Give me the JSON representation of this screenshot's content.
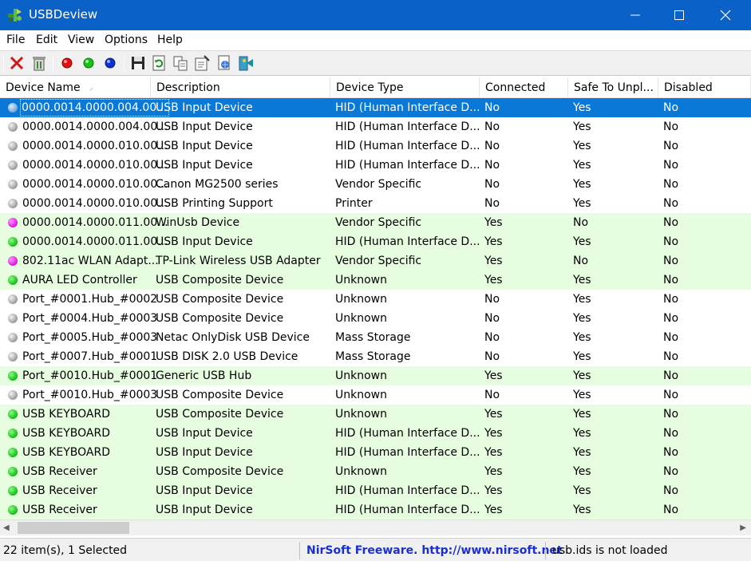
{
  "window": {
    "title": "USBDeview"
  },
  "menu": [
    "File",
    "Edit",
    "View",
    "Options",
    "Help"
  ],
  "toolbar_icons": [
    "disconnect-icon",
    "uninstall-icon",
    "red-led-icon",
    "green-led-icon",
    "blue-led-icon",
    "save-icon",
    "refresh-icon",
    "copy-icon",
    "properties-icon",
    "html-report-icon",
    "exit-icon"
  ],
  "columns": [
    "Device Name",
    "Description",
    "Device Type",
    "Connected",
    "Safe To Unpl...",
    "Disabled"
  ],
  "rows": [
    {
      "name": "0000.0014.0000.004.00...",
      "description": "USB Input Device",
      "type": "HID (Human Interface D...",
      "connected": "No",
      "safe": "Yes",
      "disabled": "No",
      "status": "blue",
      "selected": true
    },
    {
      "name": "0000.0014.0000.004.00...",
      "description": "USB Input Device",
      "type": "HID (Human Interface D...",
      "connected": "No",
      "safe": "Yes",
      "disabled": "No",
      "status": "gray"
    },
    {
      "name": "0000.0014.0000.010.00...",
      "description": "USB Input Device",
      "type": "HID (Human Interface D...",
      "connected": "No",
      "safe": "Yes",
      "disabled": "No",
      "status": "gray"
    },
    {
      "name": "0000.0014.0000.010.00...",
      "description": "USB Input Device",
      "type": "HID (Human Interface D...",
      "connected": "No",
      "safe": "Yes",
      "disabled": "No",
      "status": "gray"
    },
    {
      "name": "0000.0014.0000.010.00...",
      "description": "Canon MG2500 series",
      "type": "Vendor Specific",
      "connected": "No",
      "safe": "Yes",
      "disabled": "No",
      "status": "gray"
    },
    {
      "name": "0000.0014.0000.010.00...",
      "description": "USB Printing Support",
      "type": "Printer",
      "connected": "No",
      "safe": "Yes",
      "disabled": "No",
      "status": "gray"
    },
    {
      "name": "0000.0014.0000.011.00...",
      "description": "WinUsb Device",
      "type": "Vendor Specific",
      "connected": "Yes",
      "safe": "No",
      "disabled": "No",
      "status": "magenta"
    },
    {
      "name": "0000.0014.0000.011.00...",
      "description": "USB Input Device",
      "type": "HID (Human Interface D...",
      "connected": "Yes",
      "safe": "Yes",
      "disabled": "No",
      "status": "green"
    },
    {
      "name": "802.11ac WLAN Adapt...",
      "description": "TP-Link Wireless USB Adapter",
      "type": "Vendor Specific",
      "connected": "Yes",
      "safe": "No",
      "disabled": "No",
      "status": "magenta"
    },
    {
      "name": "AURA LED Controller",
      "description": "USB Composite Device",
      "type": "Unknown",
      "connected": "Yes",
      "safe": "Yes",
      "disabled": "No",
      "status": "green"
    },
    {
      "name": "Port_#0001.Hub_#0002",
      "description": "USB Composite Device",
      "type": "Unknown",
      "connected": "No",
      "safe": "Yes",
      "disabled": "No",
      "status": "gray"
    },
    {
      "name": "Port_#0004.Hub_#0003",
      "description": "USB Composite Device",
      "type": "Unknown",
      "connected": "No",
      "safe": "Yes",
      "disabled": "No",
      "status": "gray"
    },
    {
      "name": "Port_#0005.Hub_#0003",
      "description": "Netac OnlyDisk USB Device",
      "type": "Mass Storage",
      "connected": "No",
      "safe": "Yes",
      "disabled": "No",
      "status": "gray"
    },
    {
      "name": "Port_#0007.Hub_#0001",
      "description": "USB DISK 2.0 USB Device",
      "type": "Mass Storage",
      "connected": "No",
      "safe": "Yes",
      "disabled": "No",
      "status": "gray"
    },
    {
      "name": "Port_#0010.Hub_#0001",
      "description": "Generic USB Hub",
      "type": "Unknown",
      "connected": "Yes",
      "safe": "Yes",
      "disabled": "No",
      "status": "green"
    },
    {
      "name": "Port_#0010.Hub_#0003",
      "description": "USB Composite Device",
      "type": "Unknown",
      "connected": "No",
      "safe": "Yes",
      "disabled": "No",
      "status": "gray"
    },
    {
      "name": "USB KEYBOARD",
      "description": "USB Composite Device",
      "type": "Unknown",
      "connected": "Yes",
      "safe": "Yes",
      "disabled": "No",
      "status": "green"
    },
    {
      "name": "USB KEYBOARD",
      "description": "USB Input Device",
      "type": "HID (Human Interface D...",
      "connected": "Yes",
      "safe": "Yes",
      "disabled": "No",
      "status": "green"
    },
    {
      "name": "USB KEYBOARD",
      "description": "USB Input Device",
      "type": "HID (Human Interface D...",
      "connected": "Yes",
      "safe": "Yes",
      "disabled": "No",
      "status": "green"
    },
    {
      "name": "USB Receiver",
      "description": "USB Composite Device",
      "type": "Unknown",
      "connected": "Yes",
      "safe": "Yes",
      "disabled": "No",
      "status": "green"
    },
    {
      "name": "USB Receiver",
      "description": "USB Input Device",
      "type": "HID (Human Interface D...",
      "connected": "Yes",
      "safe": "Yes",
      "disabled": "No",
      "status": "green"
    },
    {
      "name": "USB Receiver",
      "description": "USB Input Device",
      "type": "HID (Human Interface D...",
      "connected": "Yes",
      "safe": "Yes",
      "disabled": "No",
      "status": "green"
    }
  ],
  "status": {
    "count": "22 item(s), 1 Selected",
    "nirsoft": "NirSoft Freeware.  http://www.nirsoft.net",
    "usbids": "usb.ids is not loaded"
  },
  "colors": {
    "titlebar": "#0a62c9",
    "selection": "#0a78d7",
    "connected_row": "#e6fde0",
    "nirsoft_link": "#1a2fd0"
  }
}
